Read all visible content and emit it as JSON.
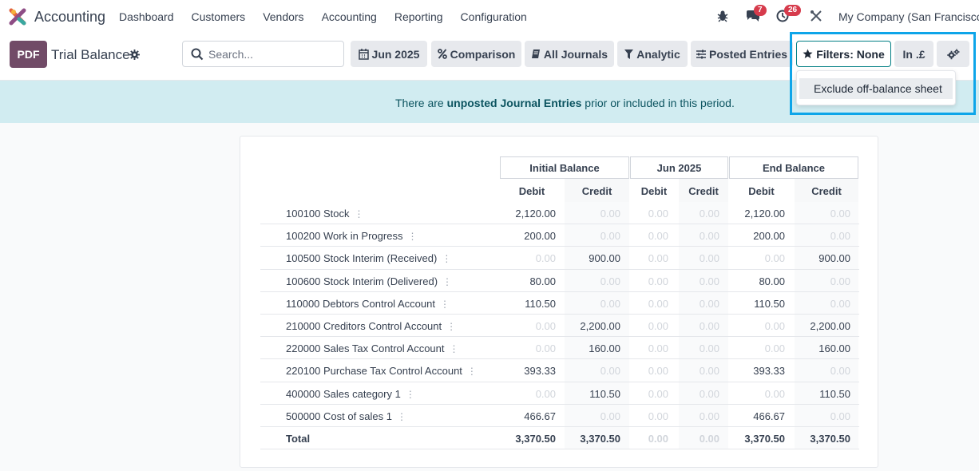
{
  "navbar": {
    "app_name": "Accounting",
    "menu": [
      "Dashboard",
      "Customers",
      "Vendors",
      "Accounting",
      "Reporting",
      "Configuration"
    ],
    "messages_count": "7",
    "activities_count": "26",
    "company": "My Company (San Francisco)"
  },
  "control": {
    "pdf_label": "PDF",
    "title": "Trial Balance",
    "search_placeholder": "Search...",
    "buttons": {
      "date": "Jun 2025",
      "comparison": "Comparison",
      "journals": "All Journals",
      "analytic": "Analytic",
      "posted": "Posted Entries",
      "filters": "Filters: None",
      "currency": "In .£"
    }
  },
  "dropdown": {
    "item": "Exclude off-balance sheet"
  },
  "alert": {
    "prefix": "There are ",
    "strong": "unposted Journal Entries",
    "suffix": " prior or included in this period."
  },
  "report": {
    "groups": [
      "Initial Balance",
      "Jun 2025",
      "End Balance"
    ],
    "subheaders": [
      "Debit",
      "Credit",
      "Debit",
      "Credit",
      "Debit",
      "Credit"
    ],
    "rows": [
      {
        "label": "100100 Stock",
        "values": [
          "2,120.00",
          "0.00",
          "0.00",
          "0.00",
          "2,120.00",
          "0.00"
        ]
      },
      {
        "label": "100200 Work in Progress",
        "values": [
          "200.00",
          "0.00",
          "0.00",
          "0.00",
          "200.00",
          "0.00"
        ]
      },
      {
        "label": "100500 Stock Interim (Received)",
        "values": [
          "0.00",
          "900.00",
          "0.00",
          "0.00",
          "0.00",
          "900.00"
        ]
      },
      {
        "label": "100600 Stock Interim (Delivered)",
        "values": [
          "80.00",
          "0.00",
          "0.00",
          "0.00",
          "80.00",
          "0.00"
        ]
      },
      {
        "label": "110000 Debtors Control Account",
        "values": [
          "110.50",
          "0.00",
          "0.00",
          "0.00",
          "110.50",
          "0.00"
        ]
      },
      {
        "label": "210000 Creditors Control Account",
        "values": [
          "0.00",
          "2,200.00",
          "0.00",
          "0.00",
          "0.00",
          "2,200.00"
        ]
      },
      {
        "label": "220000 Sales Tax Control Account",
        "values": [
          "0.00",
          "160.00",
          "0.00",
          "0.00",
          "0.00",
          "160.00"
        ]
      },
      {
        "label": "220100 Purchase Tax Control Account",
        "values": [
          "393.33",
          "0.00",
          "0.00",
          "0.00",
          "393.33",
          "0.00"
        ]
      },
      {
        "label": "400000 Sales category 1",
        "values": [
          "0.00",
          "110.50",
          "0.00",
          "0.00",
          "0.00",
          "110.50"
        ]
      },
      {
        "label": "500000 Cost of sales 1",
        "values": [
          "466.67",
          "0.00",
          "0.00",
          "0.00",
          "466.67",
          "0.00"
        ]
      }
    ],
    "total": {
      "label": "Total",
      "values": [
        "3,370.50",
        "3,370.50",
        "0.00",
        "0.00",
        "3,370.50",
        "3,370.50"
      ]
    }
  }
}
